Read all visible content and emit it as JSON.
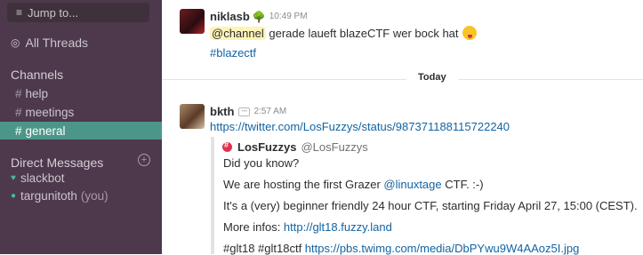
{
  "sidebar": {
    "jump_label": "Jump to...",
    "all_threads": "All Threads",
    "channels_header": "Channels",
    "channels": [
      {
        "name": "help"
      },
      {
        "name": "meetings"
      },
      {
        "name": "general",
        "active": true
      }
    ],
    "dm_header": "Direct Messages",
    "direct_messages": [
      {
        "name": "slackbot",
        "suffix": "",
        "status_icon": "heart-icon"
      },
      {
        "name": "targunitoth",
        "suffix": "(you)",
        "status_icon": "presence-dot-icon"
      }
    ]
  },
  "messages": [
    {
      "author": "niklasb",
      "time": "10:49 PM",
      "mention": "@channel",
      "text": " gerade laueft blazeCTF wer bock hat",
      "emoji": "tongue-face-icon",
      "channel_link": "#blazectf"
    },
    {
      "author": "bkth",
      "time": "2:57 AM",
      "link": "https://twitter.com/LosFuzzys/status/987371188115722240",
      "attachment": {
        "author": "LosFuzzys",
        "handle": "@LosFuzzys",
        "line1": "Did you know?",
        "line2_pre": "We are hosting the first Grazer ",
        "line2_link": "@linuxtage",
        "line2_post": " CTF. :-)",
        "line3": "It's a (very) beginner friendly 24 hour CTF, starting Friday April 27, 15:00 (CEST).",
        "line4_pre": "More infos: ",
        "line4_link": "http://glt18.fuzzy.land",
        "line5_pre": "#glt18 #glt18ctf ",
        "line5_link": "https://pbs.twimg.com/media/DbPYwu9W4AAoz5I.jpg"
      }
    }
  ],
  "divider_label": "Today",
  "colors": {
    "sidebar_bg": "#4d394b",
    "active_channel": "#4c9689",
    "link": "#1264a3",
    "mention_bg": "#fff3b8"
  }
}
